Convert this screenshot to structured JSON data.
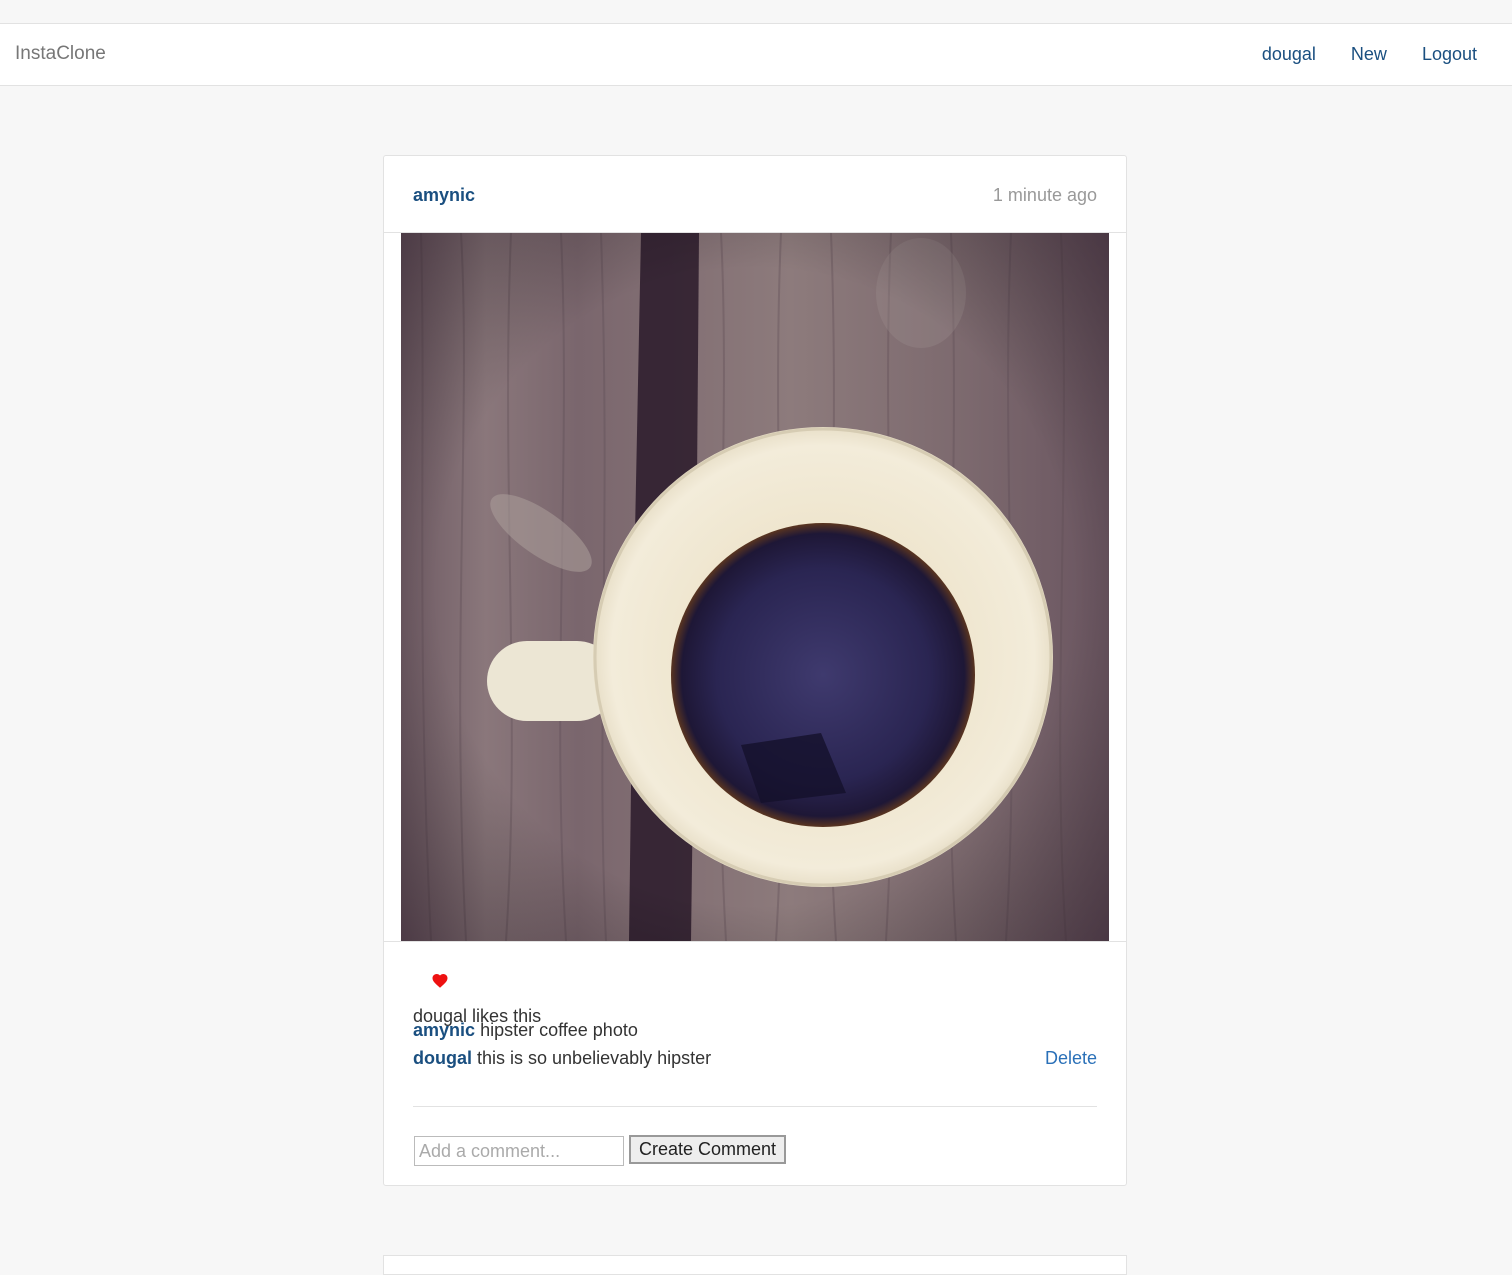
{
  "navbar": {
    "brand": "InstaClone",
    "links": [
      "dougal",
      "New",
      "Logout"
    ]
  },
  "post": {
    "author": "amynic",
    "time": "1 minute ago",
    "photo_alt": "coffee photo",
    "likes_text": "dougal likes this",
    "heart_color": "#ee1111",
    "comments": [
      {
        "user": "amynic",
        "text": "hipster coffee photo",
        "deletable": false
      },
      {
        "user": "dougal",
        "text": " this is so unbelievably hipster",
        "deletable": true,
        "delete_label": "Delete"
      }
    ],
    "comment_form": {
      "placeholder": "Add a comment...",
      "submit_label": "Create Comment"
    }
  },
  "colors": {
    "link": "#1a4f80",
    "muted": "#999999",
    "background": "#f7f7f7"
  }
}
